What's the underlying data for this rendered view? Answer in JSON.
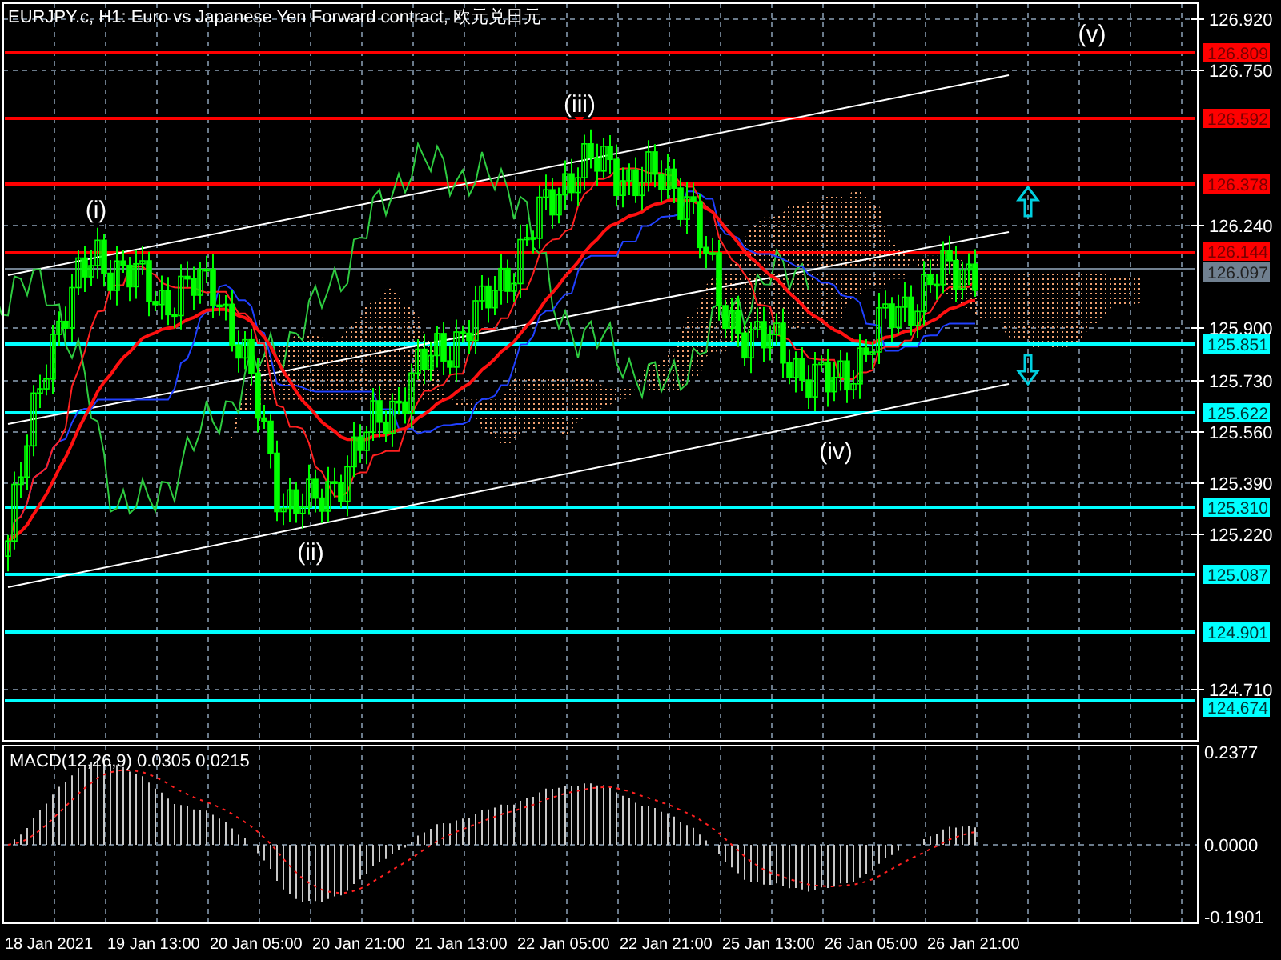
{
  "title": "EURJPY.c, H1:  Euro vs Japanese Yen Forward contract, 欧元兑日元",
  "price_axis": {
    "ticks": [
      "126.920",
      "126.750",
      "126.240",
      "125.900",
      "125.730",
      "125.560",
      "125.390",
      "125.220",
      "124.710"
    ]
  },
  "levels": [
    {
      "label": "126.809",
      "color": "#ff0000"
    },
    {
      "label": "126.592",
      "color": "#ff0000"
    },
    {
      "label": "126.378",
      "color": "#ff0000"
    },
    {
      "label": "126.144",
      "color": "#ff0000"
    },
    {
      "label": "126.097",
      "color": "#708090"
    },
    {
      "label": "125.851",
      "color": "#00ffff"
    },
    {
      "label": "125.622",
      "color": "#00ffff"
    },
    {
      "label": "125.310",
      "color": "#00ffff"
    },
    {
      "label": "125.087",
      "color": "#00ffff"
    },
    {
      "label": "124.901",
      "color": "#00ffff"
    },
    {
      "label": "124.674",
      "color": "#00ffff"
    }
  ],
  "wave_labels": [
    "(i)",
    "(ii)",
    "(iii)",
    "(iv)",
    "(v)"
  ],
  "macd": {
    "label": "MACD(12,26,9) 0.0305 0.0215",
    "ticks": [
      "0.2377",
      "0.0000",
      "-0.1901"
    ]
  },
  "time_axis": [
    "18 Jan 2021",
    "19 Jan 13:00",
    "20 Jan 05:00",
    "20 Jan 21:00",
    "21 Jan 13:00",
    "22 Jan 05:00",
    "22 Jan 21:00",
    "25 Jan 13:00",
    "26 Jan 05:00",
    "26 Jan 21:00"
  ]
}
